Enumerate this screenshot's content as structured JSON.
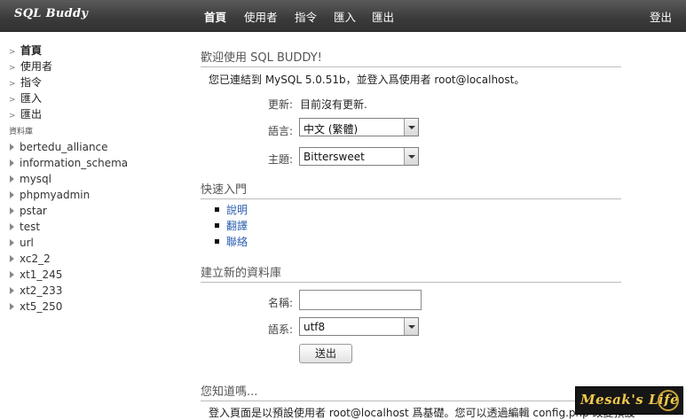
{
  "app": {
    "logo": "SQL Buddy"
  },
  "topnav": {
    "items": [
      "首頁",
      "使用者",
      "指令",
      "匯入",
      "匯出"
    ],
    "active": "首頁",
    "logout": "登出"
  },
  "sidebar": {
    "links": [
      "首頁",
      "使用者",
      "指令",
      "匯入",
      "匯出"
    ],
    "db_heading": "資料庫",
    "databases": [
      "bertedu_alliance",
      "information_schema",
      "mysql",
      "phpmyadmin",
      "pstar",
      "test",
      "url",
      "xc2_2",
      "xt1_245",
      "xt2_233",
      "xt5_250"
    ]
  },
  "main": {
    "welcome_title": "歡迎使用 SQL BUDDY!",
    "connected_text": "您已連結到 MySQL 5.0.51b，並登入爲使用者 root@localhost。",
    "update_label": "更新:",
    "update_value": "目前沒有更新.",
    "language_label": "語言:",
    "language_value": "中文 (繁體)",
    "theme_label": "主題:",
    "theme_value": "Bittersweet",
    "quick_title": "快速入門",
    "quick_links": [
      "說明",
      "翻譯",
      "聯絡"
    ],
    "create_title": "建立新的資料庫",
    "name_label": "名稱:",
    "name_value": "",
    "charset_label": "語系:",
    "charset_value": "utf8",
    "submit_label": "送出",
    "didyouknow_title": "您知道嗎...",
    "didyouknow_text": "登入頁面是以預設使用者 root@localhost 爲基礎。您可以透過編輯 config.php 改變預設"
  },
  "watermark": {
    "text": "Mesak's Life"
  },
  "colors": {
    "topbar": "#3a3a3a",
    "link": "#2a5db0",
    "watermark_text": "#f2c94c"
  }
}
